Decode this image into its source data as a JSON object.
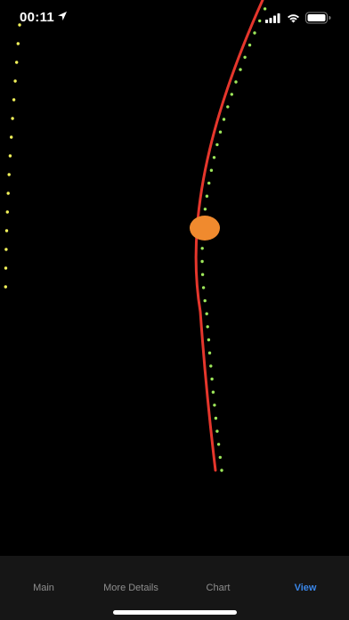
{
  "status_bar": {
    "time": "00:11",
    "location_icon": "location-arrow-icon",
    "signal_icon": "cellular-signal-icon",
    "wifi_icon": "wifi-icon",
    "battery_icon": "battery-icon"
  },
  "colors": {
    "background": "#000000",
    "trajectory_line": "#e5362c",
    "marker": "#f08a2e",
    "dots_yellow": "#f2f25a",
    "dots_green": "#9ee85a",
    "tab_inactive": "#8e8e8e",
    "tab_active": "#3a86e8",
    "tab_bar_bg": "#161616"
  },
  "tabs": [
    {
      "label": "Main",
      "active": false
    },
    {
      "label": "More Details",
      "active": false
    },
    {
      "label": "Chart",
      "active": false
    },
    {
      "label": "View",
      "active": true
    }
  ]
}
